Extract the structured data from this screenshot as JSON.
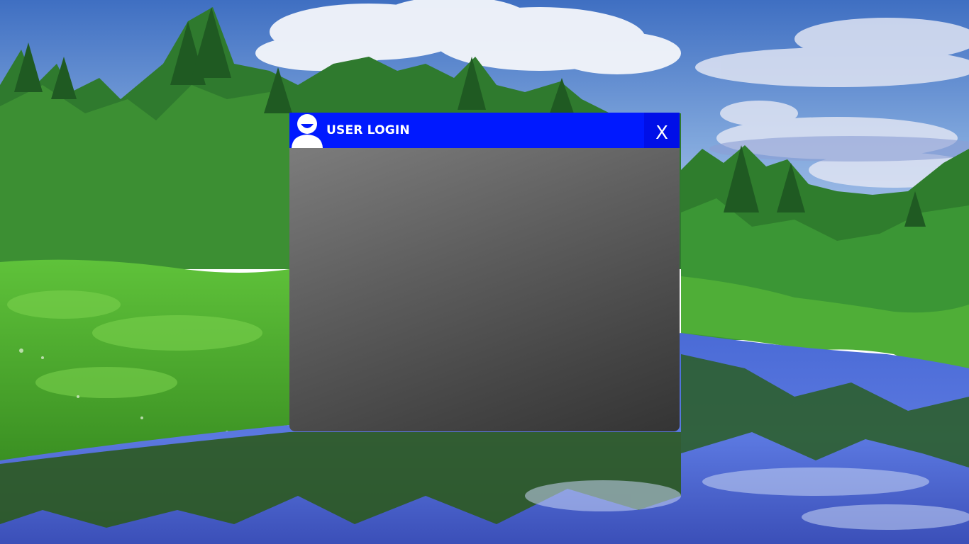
{
  "window": {
    "title": "USER LOGIN",
    "close_label": "X",
    "avatar_icon": "user-avatar-icon",
    "colors": {
      "titlebar": "#0019ff",
      "close_button": "#000fe8",
      "panel_top": "#7c7c7c",
      "panel_bottom": "#343434"
    }
  },
  "desktop": {
    "wallpaper": "forest-river-landscape"
  }
}
